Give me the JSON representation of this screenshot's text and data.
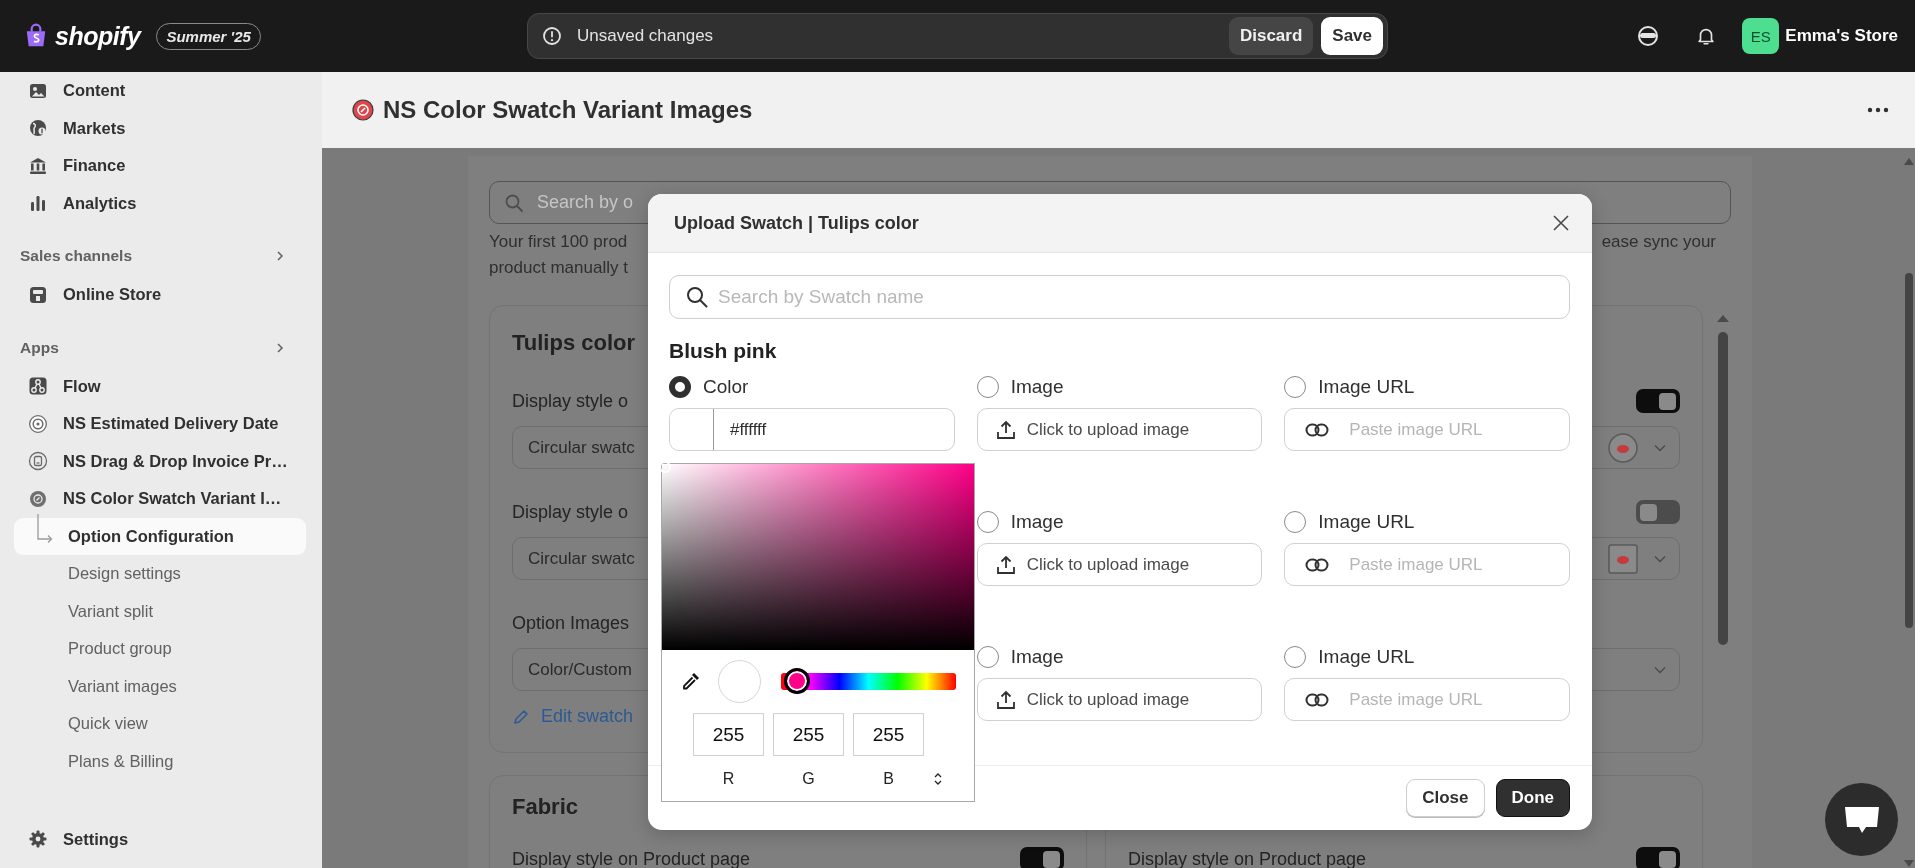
{
  "top_bar": {
    "brand": "shopify",
    "edition_badge": "Summer '25",
    "unsaved_bar": {
      "message": "Unsaved changes",
      "buttons": [
        {
          "label": "Discard",
          "kind": "secondary"
        },
        {
          "label": "Save",
          "kind": "primary"
        }
      ]
    },
    "store": {
      "initials": "ES",
      "name": "Emma's Store"
    }
  },
  "sidebar": {
    "items": [
      {
        "label": "Content",
        "selected": false
      },
      {
        "label": "Markets",
        "selected": false
      },
      {
        "label": "Finance",
        "selected": false
      },
      {
        "label": "Analytics",
        "selected": false
      }
    ],
    "sections": [
      {
        "title": "Sales channels",
        "items": [
          {
            "label": "Online Store",
            "selected": false
          }
        ]
      },
      {
        "title": "Apps",
        "items": [
          {
            "label": "Flow",
            "selected": false
          },
          {
            "label": "NS Estimated Delivery Date",
            "selected": false
          },
          {
            "label": "NS Drag & Drop Invoice Pr…",
            "selected": false
          },
          {
            "label": "NS Color Swatch Variant I…",
            "selected": false,
            "children": [
              {
                "label": "Option Configuration",
                "selected": true
              },
              {
                "label": "Design settings",
                "selected": false
              },
              {
                "label": "Variant split",
                "selected": false
              },
              {
                "label": "Product group",
                "selected": false
              },
              {
                "label": "Variant images",
                "selected": false
              },
              {
                "label": "Quick view",
                "selected": false
              },
              {
                "label": "Plans & Billing",
                "selected": false
              }
            ]
          }
        ]
      }
    ],
    "footer_item": {
      "label": "Settings",
      "selected": false
    }
  },
  "page_header": {
    "title": "NS Color Swatch Variant Images"
  },
  "page": {
    "search": {
      "placeholder": "Search by o"
    },
    "notice": {
      "left_lines": [
        "Your first 100 prod",
        "product manually t"
      ],
      "right_line": "ease sync your"
    },
    "card_rows": [
      {
        "cards": [
          {
            "title": "Tulips color",
            "rows": [
              {
                "kind": "setting",
                "label": "Display style o",
                "toggle_on": true
              },
              {
                "kind": "select",
                "value": "Circular swatc",
                "swatch_preview": true,
                "preview_rounded": true
              },
              {
                "kind": "setting",
                "label": "Display style o",
                "toggle_on": false
              },
              {
                "kind": "select",
                "value": "Circular swatc",
                "swatch_preview": true,
                "preview_rounded": false
              },
              {
                "kind": "setting",
                "label": "Option Images"
              },
              {
                "kind": "select",
                "value": "Color/Custom"
              },
              {
                "kind": "link",
                "label": "Edit swatch"
              }
            ]
          }
        ]
      },
      {
        "cards": [
          {
            "title": "Fabric",
            "rows": [
              {
                "kind": "setting",
                "label": "Display style on Product page",
                "toggle_on": true
              }
            ]
          },
          {
            "rows": [
              {
                "kind": "setting",
                "label": "Display style on Product page",
                "toggle_on": true
              }
            ]
          }
        ]
      }
    ]
  },
  "modal": {
    "title": "Upload Swatch | Tulips color",
    "search": {
      "placeholder": "Search by Swatch name"
    },
    "swatches": [
      {
        "name": "Blush pink",
        "options": [
          {
            "kind": "color",
            "label": "Color",
            "selected": true,
            "value": "#ffffff"
          },
          {
            "kind": "image",
            "label": "Image",
            "selected": false,
            "button": "Click to upload image"
          },
          {
            "kind": "url",
            "label": "Image URL",
            "selected": false,
            "placeholder": "Paste image URL"
          }
        ]
      },
      {
        "options": [
          {
            "kind": "image",
            "label": "Image",
            "selected": false,
            "button": "Click to upload image"
          },
          {
            "kind": "url",
            "label": "Image URL",
            "selected": false,
            "placeholder": "Paste image URL"
          }
        ]
      },
      {
        "options": [
          {
            "kind": "image",
            "label": "Image",
            "selected": false,
            "button": "Click to upload image"
          },
          {
            "kind": "url",
            "label": "Image URL",
            "selected": false,
            "placeholder": "Paste image URL"
          }
        ]
      }
    ],
    "color_picker": {
      "hue": {
        "level": 0.09
      },
      "channels": [
        {
          "value": "255",
          "label": "R"
        },
        {
          "value": "255",
          "label": "G"
        },
        {
          "value": "255",
          "label": "B"
        }
      ]
    },
    "buttons": [
      {
        "label": "Close",
        "kind": "secondary"
      },
      {
        "label": "Done",
        "kind": "primary"
      }
    ]
  }
}
